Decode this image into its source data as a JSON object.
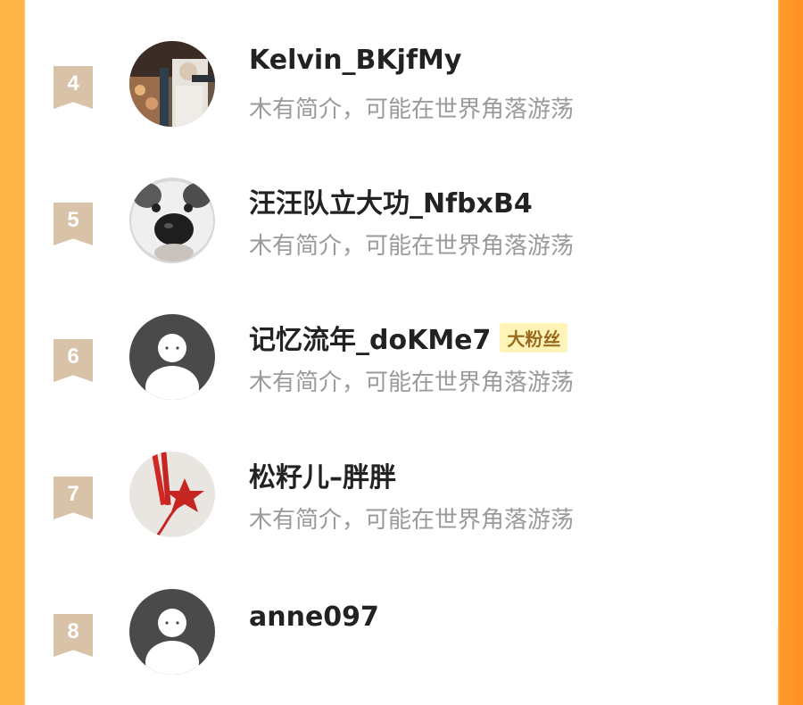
{
  "list": {
    "rows": [
      {
        "rank": "4",
        "name": "Kelvin_BKjfMy",
        "badge": "",
        "bio": "木有简介，可能在世界角落游荡",
        "avatar": "photo-person"
      },
      {
        "rank": "5",
        "name": "汪汪队立大功_NfbxB4",
        "badge": "",
        "bio": "木有简介，可能在世界角落游荡",
        "avatar": "photo-dog"
      },
      {
        "rank": "6",
        "name": "记忆流年_doKMe7",
        "badge": "大粉丝",
        "bio": "木有简介，可能在世界角落游荡",
        "avatar": "default-avatar"
      },
      {
        "rank": "7",
        "name": "松籽儿–胖胖",
        "badge": "",
        "bio": "木有简介，可能在世界角落游荡",
        "avatar": "photo-ornament"
      },
      {
        "rank": "8",
        "name": "anne097",
        "badge": "",
        "bio": "",
        "avatar": "default-avatar"
      }
    ]
  },
  "colors": {
    "accent_orange": "#ff9c2c",
    "rank_badge": "#d8c2a8",
    "fan_badge_bg": "#fff4b8",
    "fan_badge_text": "#9a6a1e",
    "bio_text": "#9a9a9a"
  }
}
